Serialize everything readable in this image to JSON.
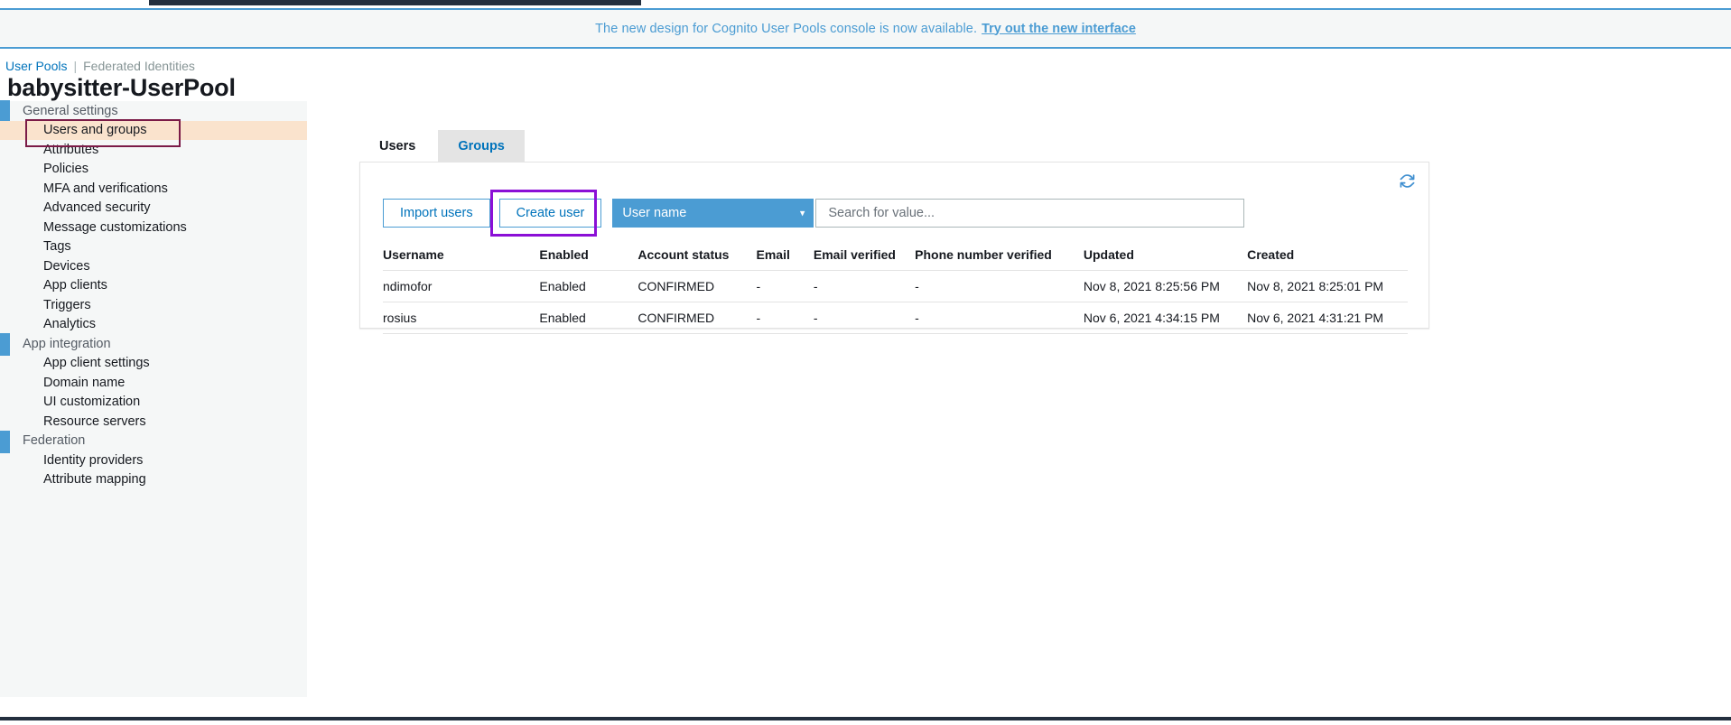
{
  "banner": {
    "message": "The new design for Cognito User Pools console is now available.",
    "link_label": "Try out the new interface"
  },
  "breadcrumb": {
    "active": "User Pools",
    "separator": "|",
    "inactive": "Federated Identities"
  },
  "page": {
    "title": "babysitter-UserPool"
  },
  "sidebar": {
    "groups": [
      {
        "label": "General settings",
        "items": [
          {
            "label": "Users and groups",
            "highlighted": true
          },
          {
            "label": "Attributes",
            "highlighted": false
          },
          {
            "label": "Policies",
            "highlighted": false
          },
          {
            "label": "MFA and verifications",
            "highlighted": false
          },
          {
            "label": "Advanced security",
            "highlighted": false
          },
          {
            "label": "Message customizations",
            "highlighted": false
          },
          {
            "label": "Tags",
            "highlighted": false
          },
          {
            "label": "Devices",
            "highlighted": false
          },
          {
            "label": "App clients",
            "highlighted": false
          },
          {
            "label": "Triggers",
            "highlighted": false
          },
          {
            "label": "Analytics",
            "highlighted": false
          }
        ]
      },
      {
        "label": "App integration",
        "items": [
          {
            "label": "App client settings",
            "highlighted": false
          },
          {
            "label": "Domain name",
            "highlighted": false
          },
          {
            "label": "UI customization",
            "highlighted": false
          },
          {
            "label": "Resource servers",
            "highlighted": false
          }
        ]
      },
      {
        "label": "Federation",
        "items": [
          {
            "label": "Identity providers",
            "highlighted": false
          },
          {
            "label": "Attribute mapping",
            "highlighted": false
          }
        ]
      }
    ]
  },
  "tabs": [
    {
      "label": "Users",
      "active": true
    },
    {
      "label": "Groups",
      "active": false
    }
  ],
  "toolbar": {
    "import_users_label": "Import users",
    "create_user_label": "Create user",
    "filter_select_value": "User name",
    "search_placeholder": "Search for value...",
    "search_value": "",
    "refresh_icon": "refresh-icon"
  },
  "table": {
    "headers": [
      "Username",
      "Enabled",
      "Account status",
      "Email",
      "Email verified",
      "Phone number verified",
      "Updated",
      "Created"
    ],
    "rows": [
      {
        "username": "ndimofor",
        "enabled": "Enabled",
        "account_status": "CONFIRMED",
        "email": "-",
        "email_verified": "-",
        "phone_number_verified": "-",
        "updated": "Nov 8, 2021 8:25:56 PM",
        "created": "Nov 8, 2021 8:25:01 PM"
      },
      {
        "username": "rosius",
        "enabled": "Enabled",
        "account_status": "CONFIRMED",
        "email": "-",
        "email_verified": "-",
        "phone_number_verified": "-",
        "updated": "Nov 6, 2021 4:34:15 PM",
        "created": "Nov 6, 2021 4:31:21 PM"
      }
    ]
  },
  "colors": {
    "accent_blue": "#4b9cd3",
    "link_blue": "#0073bb",
    "highlight_border": "#7b1b47",
    "highlight_fill": "#fae3cd",
    "callout_purple": "#8b0fd6",
    "aws_navy": "#232f3e"
  }
}
